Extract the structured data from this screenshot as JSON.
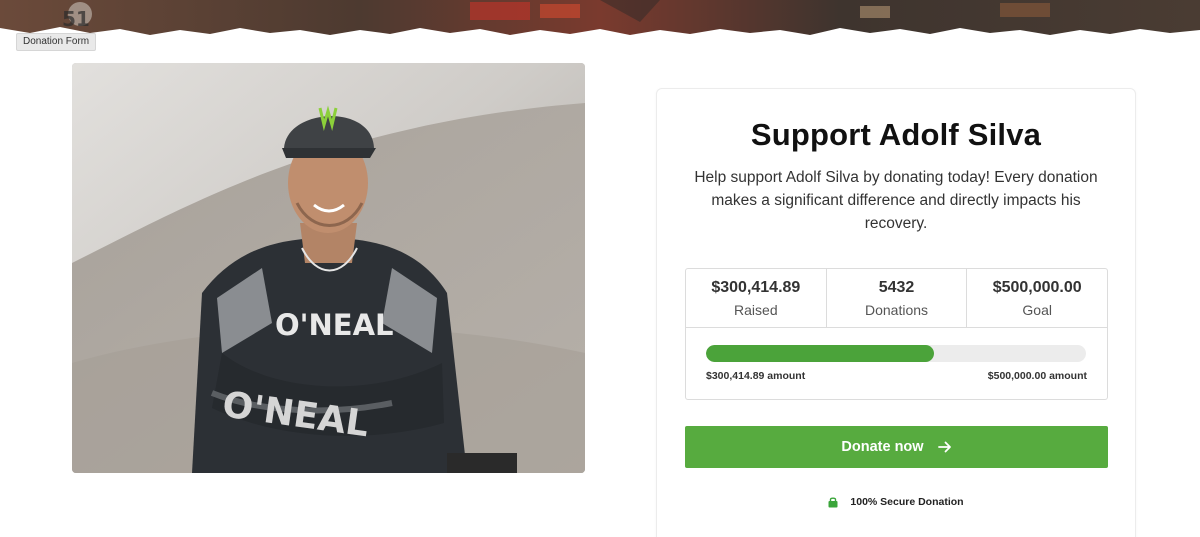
{
  "header": {
    "form_label": "Donation Form"
  },
  "photo": {
    "alt": "Adolf Silva portrait"
  },
  "campaign": {
    "title": "Support Adolf Silva",
    "description": "Help support Adolf Silva by donating today! Every donation makes a significant difference and directly impacts his recovery."
  },
  "stats": {
    "raised_value": "$300,414.89",
    "raised_label": "Raised",
    "donations_value": "5432",
    "donations_label": "Donations",
    "goal_value": "$500,000.00",
    "goal_label": "Goal"
  },
  "progress": {
    "fraction": 0.6008,
    "left_label": "$300,414.89 amount",
    "right_label": "$500,000.00 amount"
  },
  "donate_button": {
    "label": "Donate now",
    "icon": "arrow-right-icon"
  },
  "secure": {
    "label": "100% Secure Donation",
    "icon": "lock-icon"
  },
  "colors": {
    "accent": "#57ab3f",
    "progress_fill": "#4ba33a",
    "progress_track": "#ececec"
  }
}
